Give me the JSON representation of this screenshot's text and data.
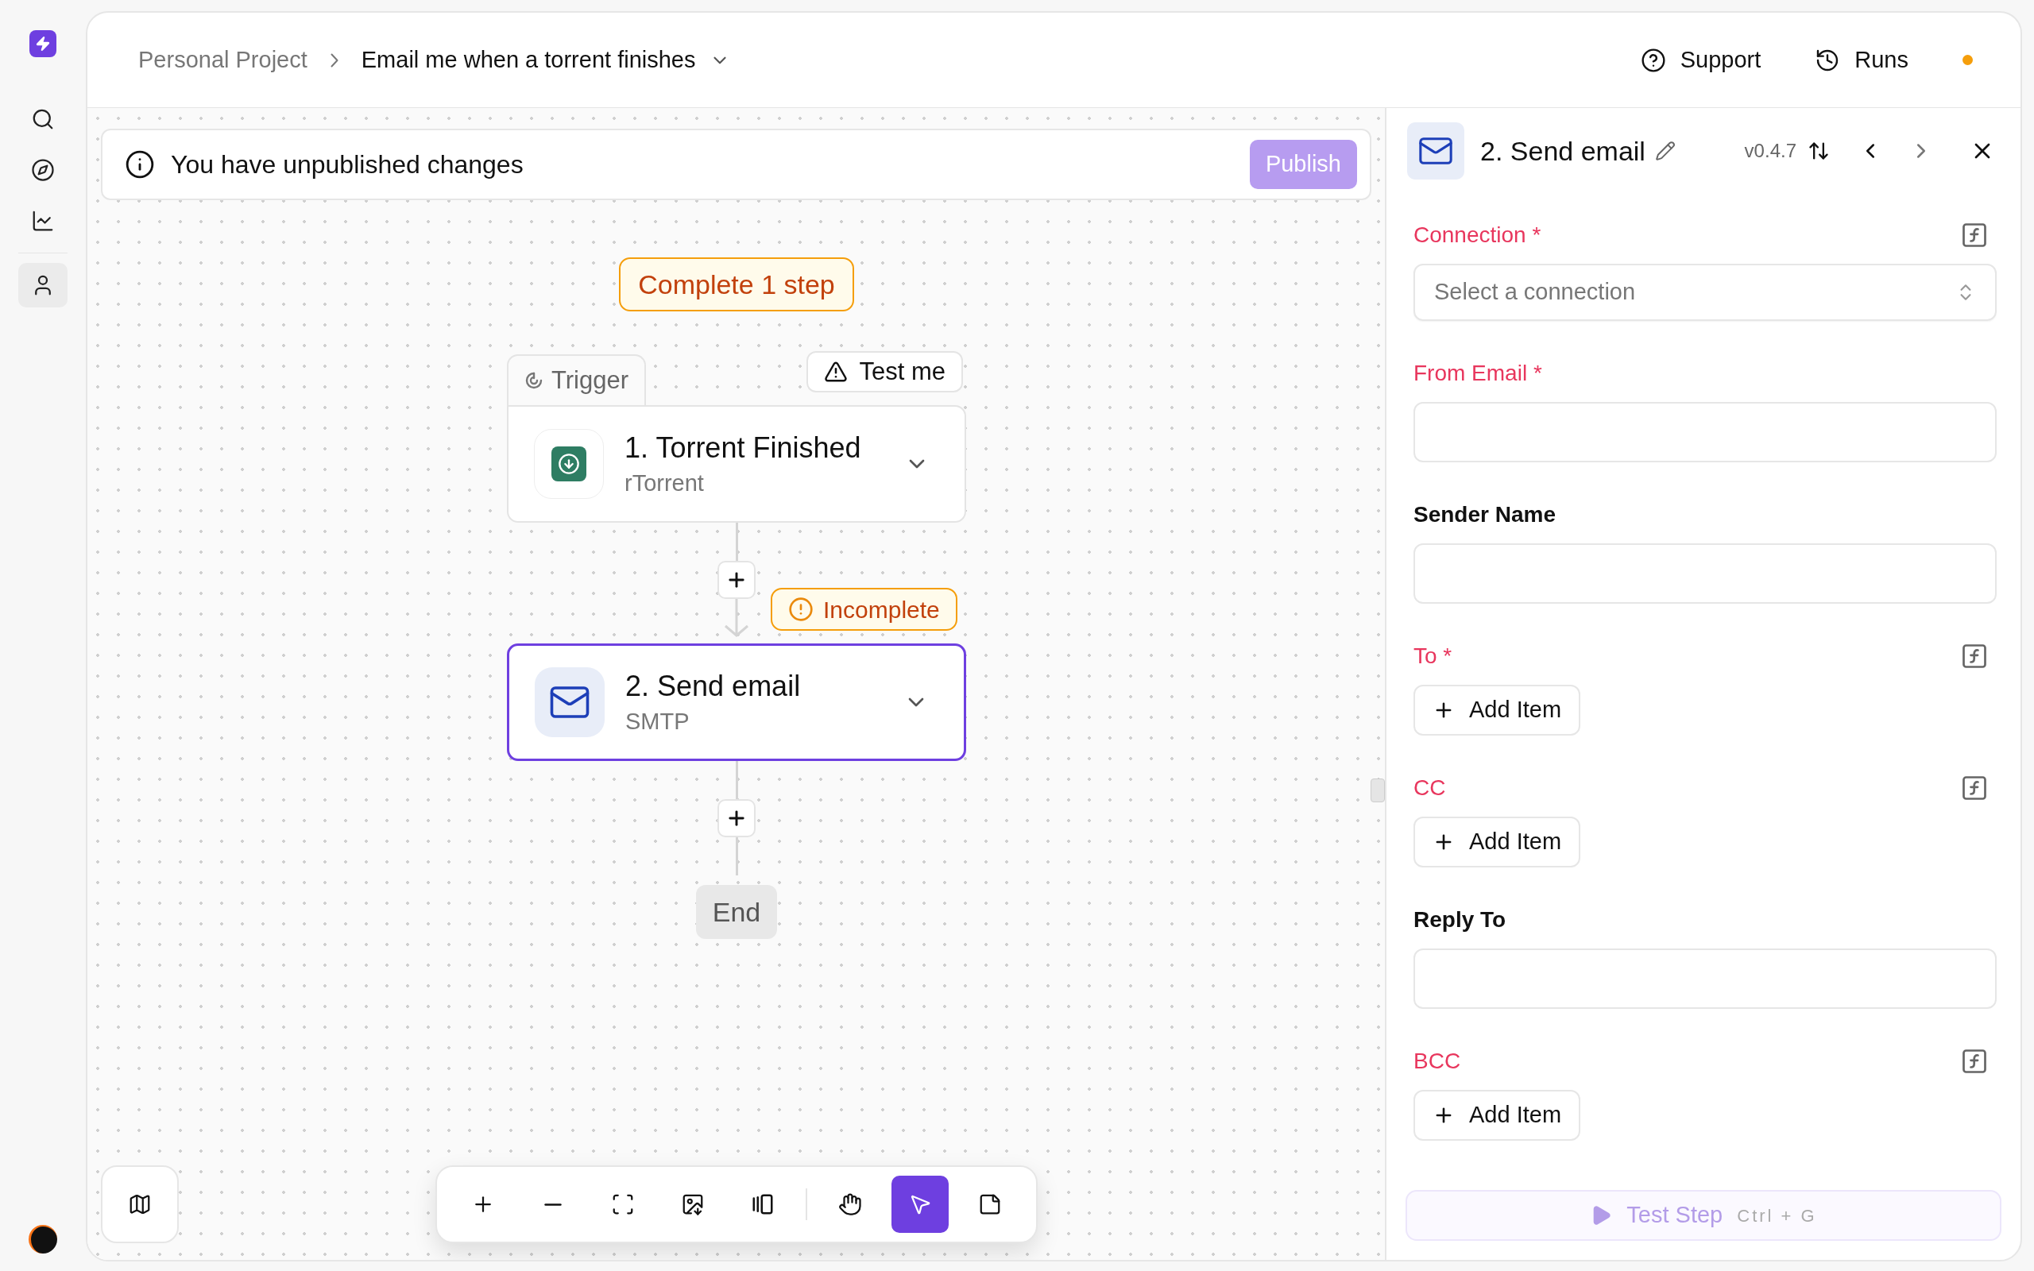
{
  "sidebar": {
    "items": [
      {
        "kind": "search",
        "selected": false
      },
      {
        "kind": "explore",
        "selected": false
      },
      {
        "kind": "chart",
        "selected": false
      },
      {
        "kind": "user",
        "selected": true
      }
    ]
  },
  "breadcrumb": {
    "project": "Personal Project",
    "flow": "Email me when a torrent finishes"
  },
  "header_actions": [
    {
      "kind": "support",
      "label": "Support"
    },
    {
      "kind": "runs",
      "label": "Runs"
    }
  ],
  "banner": {
    "message": "You have unpublished changes",
    "button": "Publish",
    "disabled": true
  },
  "canvas": {
    "summary_badge": "Complete 1 step",
    "trigger_tab": "Trigger",
    "test_button": "Test me",
    "steps": [
      {
        "kind": "trigger",
        "title": "1. Torrent Finished",
        "subtitle": "rTorrent",
        "selected": false
      },
      {
        "kind": "email",
        "title": "2. Send email",
        "subtitle": "SMTP",
        "selected": true,
        "badge": "Incomplete"
      }
    ],
    "end_label": "End"
  },
  "toolbar": {
    "tools": [
      {
        "kind": "zoom-in",
        "selected": false
      },
      {
        "kind": "zoom-out",
        "selected": false
      },
      {
        "kind": "fit",
        "selected": false
      },
      {
        "kind": "export",
        "selected": false
      },
      {
        "kind": "layout",
        "selected": false
      },
      {
        "kind": "pan",
        "selected": false
      },
      {
        "kind": "select",
        "selected": true
      },
      {
        "kind": "note",
        "selected": false
      }
    ]
  },
  "panel": {
    "title": "2. Send email",
    "version": "v0.4.7",
    "fields": [
      {
        "kind": "select",
        "label": "Connection *",
        "invalid": true,
        "formula": true,
        "placeholder": "Select a connection"
      },
      {
        "kind": "text",
        "label": "From Email *",
        "invalid": true,
        "formula": false
      },
      {
        "kind": "text",
        "label": "Sender Name",
        "invalid": false,
        "formula": false
      },
      {
        "kind": "list",
        "label": "To *",
        "invalid": true,
        "formula": true,
        "button": "Add Item"
      },
      {
        "kind": "list",
        "label": "CC",
        "invalid": true,
        "formula": true,
        "button": "Add Item"
      },
      {
        "kind": "text",
        "label": "Reply To",
        "invalid": false,
        "formula": false
      },
      {
        "kind": "list",
        "label": "BCC",
        "invalid": true,
        "formula": true,
        "button": "Add Item"
      }
    ],
    "test_button": "Test Step",
    "shortcut": "Ctrl + G",
    "test_disabled": true
  }
}
